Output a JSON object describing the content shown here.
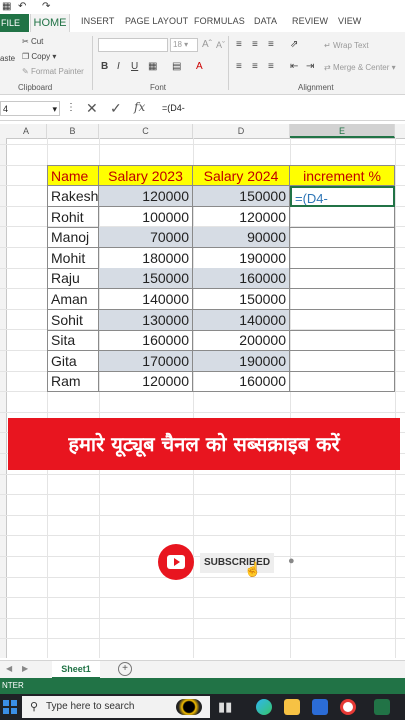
{
  "titlebar": {
    "undo_icon": "undo-icon",
    "redo_icon": "redo-icon",
    "save_icon": "save-icon"
  },
  "tabs": [
    "FILE",
    "HOME",
    "INSERT",
    "PAGE LAYOUT",
    "FORMULAS",
    "DATA",
    "REVIEW",
    "VIEW"
  ],
  "ribbon": {
    "cut": "Cut",
    "copy": "Copy",
    "format_painter": "Format Painter",
    "paste_fragment": "aste",
    "clipboard": "Clipboard",
    "font_size": "18",
    "font_grow": "A",
    "font_shrink": "A",
    "bold": "B",
    "italic": "I",
    "underline": "U",
    "font_color": "A",
    "font_group": "Font",
    "wrap_text": "Wrap Text",
    "merge_center": "Merge & Center",
    "alignment": "Alignment"
  },
  "formula_bar": {
    "name_box": "4",
    "fx": "fx",
    "formula": "=(D4-"
  },
  "columns": [
    "A",
    "B",
    "C",
    "D",
    "E"
  ],
  "table": {
    "headers": [
      "Name",
      "Salary 2023",
      "Salary 2024",
      "increment %"
    ],
    "rows": [
      {
        "name": "Rakesh",
        "s2023": "120000",
        "s2024": "150000",
        "inc": "=(D4-"
      },
      {
        "name": "Rohit",
        "s2023": "100000",
        "s2024": "120000",
        "inc": ""
      },
      {
        "name": "Manoj",
        "s2023": "70000",
        "s2024": "90000",
        "inc": ""
      },
      {
        "name": "Mohit",
        "s2023": "180000",
        "s2024": "190000",
        "inc": ""
      },
      {
        "name": "Raju",
        "s2023": "150000",
        "s2024": "160000",
        "inc": ""
      },
      {
        "name": "Aman",
        "s2023": "140000",
        "s2024": "150000",
        "inc": ""
      },
      {
        "name": "Sohit",
        "s2023": "130000",
        "s2024": "140000",
        "inc": ""
      },
      {
        "name": "Sita",
        "s2023": "160000",
        "s2024": "200000",
        "inc": ""
      },
      {
        "name": "Gita",
        "s2023": "170000",
        "s2024": "190000",
        "inc": ""
      },
      {
        "name": "Ram",
        "s2023": "120000",
        "s2024": "160000",
        "inc": ""
      }
    ]
  },
  "banner": {
    "text": "हमारे यूट्यूब चैनल को सब्सक्राइब करें"
  },
  "subscribe": {
    "label": "SUBSCRIBED"
  },
  "sheets": {
    "active": "Sheet1"
  },
  "status": {
    "mode": "NTER"
  },
  "taskbar": {
    "search_placeholder": "Type here to search"
  },
  "colors": {
    "excel_green": "#217346",
    "header_fill": "#ffff00",
    "header_text": "#c00000",
    "row_shade": "#d6dce4",
    "banner_red": "#e8151f"
  }
}
